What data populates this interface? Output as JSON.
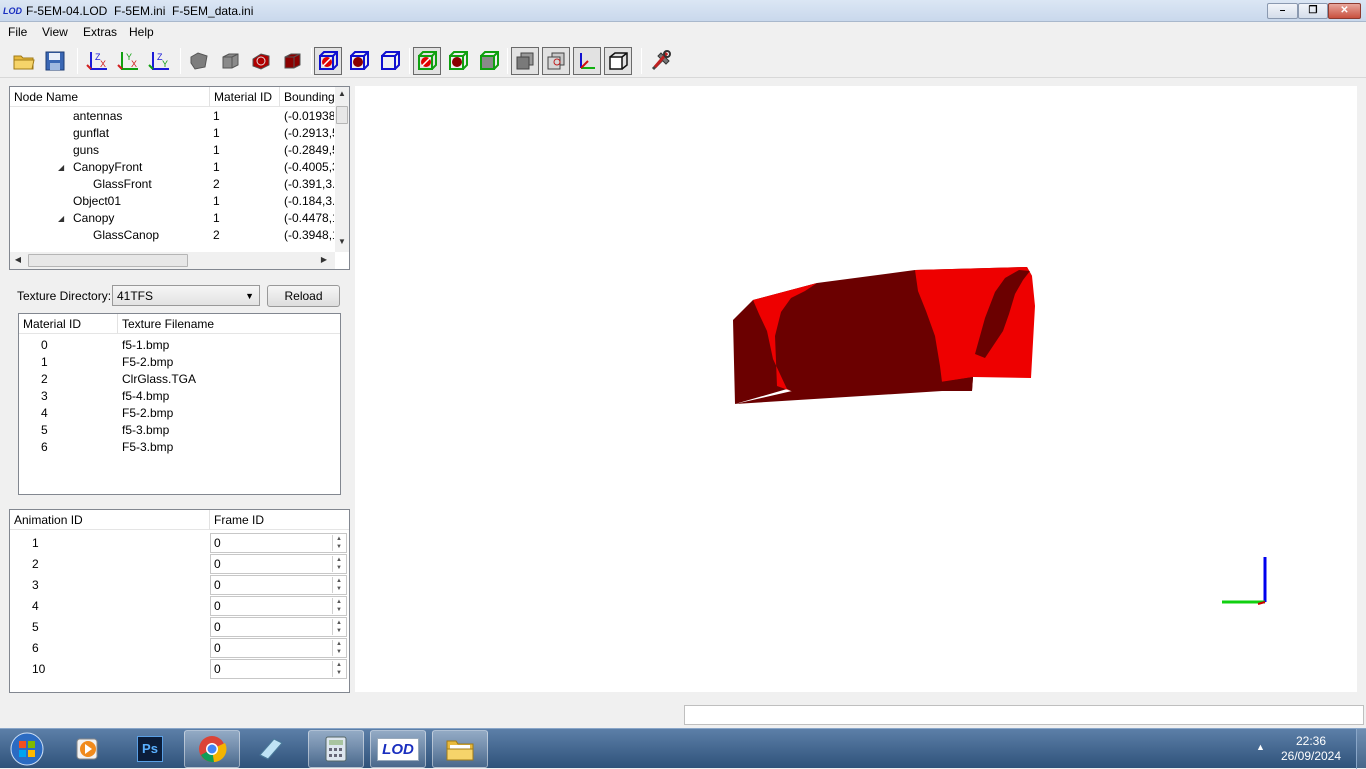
{
  "window": {
    "icon_text": "LOD",
    "title": "F-5EM-04.LOD  F-5EM.ini  F-5EM_data.ini"
  },
  "menu": [
    "File",
    "View",
    "Extras",
    "Help"
  ],
  "toolbar": {
    "axis_buttons": [
      {
        "a": "Z",
        "b": "X"
      },
      {
        "a": "Y",
        "b": "X"
      },
      {
        "a": "Z",
        "b": "Y"
      }
    ]
  },
  "node_table": {
    "headers": [
      "Node Name",
      "Material ID",
      "Bounding"
    ],
    "rows": [
      {
        "name": "antennas",
        "material": "1",
        "bounding": "(-0.01938,",
        "indent": 0,
        "expandable": false
      },
      {
        "name": "gunflat",
        "material": "1",
        "bounding": "(-0.2913,5",
        "indent": 0,
        "expandable": false
      },
      {
        "name": "guns",
        "material": "1",
        "bounding": "(-0.2849,5",
        "indent": 0,
        "expandable": false
      },
      {
        "name": "CanopyFront",
        "material": "1",
        "bounding": "(-0.4005,3",
        "indent": 0,
        "expandable": true
      },
      {
        "name": "GlassFront",
        "material": "2",
        "bounding": "(-0.391,3.(",
        "indent": 1,
        "expandable": false
      },
      {
        "name": "Object01",
        "material": "1",
        "bounding": "(-0.184,3.8",
        "indent": 0,
        "expandable": false
      },
      {
        "name": "Canopy",
        "material": "1",
        "bounding": "(-0.4478,1",
        "indent": 0,
        "expandable": true
      },
      {
        "name": "GlassCanop",
        "material": "2",
        "bounding": "(-0.3948,1",
        "indent": 1,
        "expandable": false
      }
    ]
  },
  "texture": {
    "label": "Texture Directory:",
    "directory": "41TFS",
    "reload_label": "Reload",
    "headers": [
      "Material ID",
      "Texture Filename"
    ],
    "rows": [
      {
        "id": "0",
        "file": "f5-1.bmp"
      },
      {
        "id": "1",
        "file": "F5-2.bmp"
      },
      {
        "id": "2",
        "file": "ClrGlass.TGA"
      },
      {
        "id": "3",
        "file": "f5-4.bmp"
      },
      {
        "id": "4",
        "file": "F5-2.bmp"
      },
      {
        "id": "5",
        "file": "f5-3.bmp"
      },
      {
        "id": "6",
        "file": "F5-3.bmp"
      }
    ]
  },
  "animation": {
    "headers": [
      "Animation ID",
      "Frame ID"
    ],
    "rows": [
      {
        "id": "1",
        "frame": "0"
      },
      {
        "id": "2",
        "frame": "0"
      },
      {
        "id": "3",
        "frame": "0"
      },
      {
        "id": "4",
        "frame": "0"
      },
      {
        "id": "5",
        "frame": "0"
      },
      {
        "id": "6",
        "frame": "0"
      },
      {
        "id": "10",
        "frame": "0"
      }
    ]
  },
  "colors": {
    "model_dark": "#6b0000",
    "model_bright": "#ee0000",
    "axis_y": "#10d010",
    "axis_z": "#0000ee"
  },
  "taskbar": {
    "apps": [
      "start-orb",
      "media-player",
      "photoshop",
      "chrome",
      "notepad",
      "calculator",
      "lod-editor",
      "file-explorer"
    ],
    "ps_label": "Ps",
    "lod_label": "LOD",
    "time": "22:36",
    "date": "26/09/2024"
  }
}
